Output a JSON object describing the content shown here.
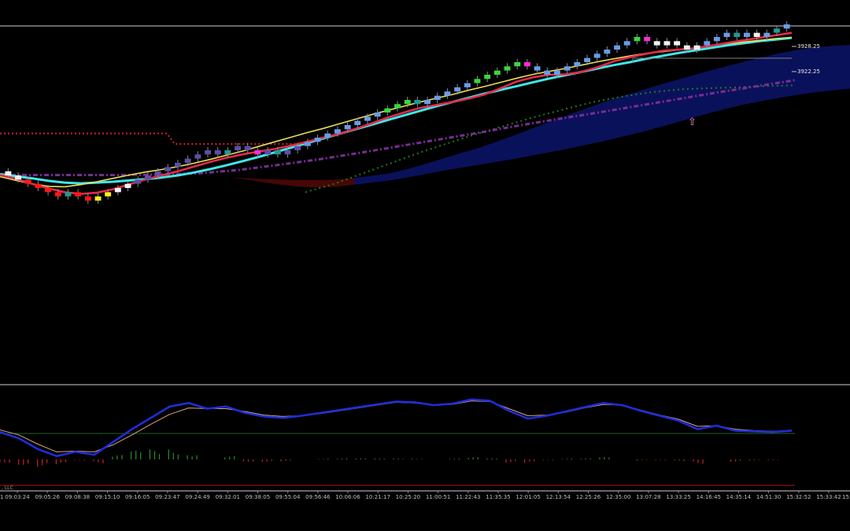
{
  "colors": {
    "background": "#000000",
    "frame": "#cfcfcf",
    "renko_up": "#6a9be8",
    "renko_strong_up": "#38d83a",
    "renko_down": "#5b4ea8",
    "renko_strong_down": "#ff1616",
    "renko_neutral": "#f2f2f2",
    "renko_signal_magenta": "#ff2bd6",
    "renko_signal_teal": "#1f9c95",
    "renko_signal_yellow": "#ffee1a",
    "ma_fast": "#e52a4a",
    "ma_mid": "#e8df55",
    "ma_slow": "#3fe7e9",
    "cloud_bull": "#0b1260",
    "cloud_bear": "#4a0707",
    "dotted_red": "#d21f2f",
    "dotted_green": "#1f7a1f",
    "dotted_purple": "#7a2c93",
    "osc_main": "#1f2dd8",
    "osc_signal": "#d6a37a",
    "hist_pos": "#2f8a2f",
    "hist_neg": "#d02020"
  },
  "chart_data": [
    {
      "type": "line",
      "panel": "price",
      "y_axis_labels": [
        "3928.25",
        "3922.25"
      ],
      "x_tick_labels": [
        "09:03:24",
        "09:05:26",
        "09:08:38",
        "09:15:10",
        "09:16:05",
        "09:23:47",
        "09:24:49",
        "09:32:01",
        "09:38:05",
        "09:55:04",
        "09:56:46",
        "10:06:06",
        "10:21:17",
        "10:25:20",
        "11:00:51",
        "11:22:43",
        "11:35:35",
        "12:01:05",
        "12:13:54",
        "12:25:26",
        "12:35:00",
        "13:07:28",
        "13:33:25",
        "14:16:45",
        "14:35:14",
        "14:51:30",
        "15:32:52",
        "15:33:42"
      ],
      "x_tick_label_left_clipped": "1",
      "x_tick_label_right_clipped": "15:",
      "renko_bricks": [
        {
          "o": 3898.5,
          "c": 3897.5,
          "color": "neutral"
        },
        {
          "o": 3897.5,
          "c": 3896.5,
          "color": "neutral"
        },
        {
          "o": 3896.5,
          "c": 3895.5,
          "color": "strong_down"
        },
        {
          "o": 3895.5,
          "c": 3894.5,
          "color": "strong_down"
        },
        {
          "o": 3894.5,
          "c": 3893.5,
          "color": "strong_down"
        },
        {
          "o": 3893.5,
          "c": 3892.5,
          "color": "strong_down"
        },
        {
          "o": 3892.5,
          "c": 3893.5,
          "color": "teal"
        },
        {
          "o": 3893.5,
          "c": 3892.5,
          "color": "strong_down"
        },
        {
          "o": 3892.5,
          "c": 3891.5,
          "color": "strong_down"
        },
        {
          "o": 3891.5,
          "c": 3892.5,
          "color": "yellow"
        },
        {
          "o": 3892.5,
          "c": 3893.5,
          "color": "yellow"
        },
        {
          "o": 3893.5,
          "c": 3894.5,
          "color": "neutral"
        },
        {
          "o": 3894.5,
          "c": 3895.5,
          "color": "neutral"
        },
        {
          "o": 3895.5,
          "c": 3896.5,
          "color": "down"
        },
        {
          "o": 3896.5,
          "c": 3897.5,
          "color": "down"
        },
        {
          "o": 3897.5,
          "c": 3898.5,
          "color": "down"
        },
        {
          "o": 3898.5,
          "c": 3899.5,
          "color": "down"
        },
        {
          "o": 3899.5,
          "c": 3900.5,
          "color": "down"
        },
        {
          "o": 3900.5,
          "c": 3901.5,
          "color": "down"
        },
        {
          "o": 3901.5,
          "c": 3902.5,
          "color": "down"
        },
        {
          "o": 3902.5,
          "c": 3903.5,
          "color": "down"
        },
        {
          "o": 3903.5,
          "c": 3902.5,
          "color": "down"
        },
        {
          "o": 3902.5,
          "c": 3903.5,
          "color": "teal"
        },
        {
          "o": 3903.5,
          "c": 3904.5,
          "color": "down"
        },
        {
          "o": 3904.5,
          "c": 3903.5,
          "color": "down"
        },
        {
          "o": 3903.5,
          "c": 3902.5,
          "color": "magenta"
        },
        {
          "o": 3902.5,
          "c": 3903.5,
          "color": "down"
        },
        {
          "o": 3903.5,
          "c": 3902.5,
          "color": "teal"
        },
        {
          "o": 3902.5,
          "c": 3903.5,
          "color": "down"
        },
        {
          "o": 3903.5,
          "c": 3904.5,
          "color": "down"
        },
        {
          "o": 3904.5,
          "c": 3905.5,
          "color": "up"
        },
        {
          "o": 3905.5,
          "c": 3906.5,
          "color": "up"
        },
        {
          "o": 3906.5,
          "c": 3907.5,
          "color": "up"
        },
        {
          "o": 3907.5,
          "c": 3908.5,
          "color": "up"
        },
        {
          "o": 3908.5,
          "c": 3909.5,
          "color": "up"
        },
        {
          "o": 3909.5,
          "c": 3910.5,
          "color": "up"
        },
        {
          "o": 3910.5,
          "c": 3911.5,
          "color": "up"
        },
        {
          "o": 3911.5,
          "c": 3912.5,
          "color": "up"
        },
        {
          "o": 3912.5,
          "c": 3913.5,
          "color": "strong_up"
        },
        {
          "o": 3913.5,
          "c": 3914.5,
          "color": "strong_up"
        },
        {
          "o": 3914.5,
          "c": 3915.5,
          "color": "strong_up"
        },
        {
          "o": 3915.5,
          "c": 3914.5,
          "color": "teal"
        },
        {
          "o": 3914.5,
          "c": 3915.5,
          "color": "up"
        },
        {
          "o": 3915.5,
          "c": 3916.5,
          "color": "up"
        },
        {
          "o": 3916.5,
          "c": 3917.5,
          "color": "up"
        },
        {
          "o": 3917.5,
          "c": 3918.5,
          "color": "up"
        },
        {
          "o": 3918.5,
          "c": 3919.5,
          "color": "up"
        },
        {
          "o": 3919.5,
          "c": 3920.5,
          "color": "strong_up"
        },
        {
          "o": 3920.5,
          "c": 3921.5,
          "color": "strong_up"
        },
        {
          "o": 3921.5,
          "c": 3922.5,
          "color": "strong_up"
        },
        {
          "o": 3922.5,
          "c": 3923.5,
          "color": "strong_up"
        },
        {
          "o": 3923.5,
          "c": 3924.5,
          "color": "strong_up"
        },
        {
          "o": 3924.5,
          "c": 3923.5,
          "color": "magenta"
        },
        {
          "o": 3923.5,
          "c": 3922.5,
          "color": "up"
        },
        {
          "o": 3922.5,
          "c": 3921.5,
          "color": "up"
        },
        {
          "o": 3921.5,
          "c": 3922.5,
          "color": "up"
        },
        {
          "o": 3922.5,
          "c": 3923.5,
          "color": "up"
        },
        {
          "o": 3923.5,
          "c": 3924.5,
          "color": "up"
        },
        {
          "o": 3924.5,
          "c": 3925.5,
          "color": "up"
        },
        {
          "o": 3925.5,
          "c": 3926.5,
          "color": "up"
        },
        {
          "o": 3926.5,
          "c": 3927.5,
          "color": "up"
        },
        {
          "o": 3927.5,
          "c": 3928.5,
          "color": "up"
        },
        {
          "o": 3928.5,
          "c": 3929.5,
          "color": "up"
        },
        {
          "o": 3929.5,
          "c": 3930.5,
          "color": "strong_up"
        },
        {
          "o": 3930.5,
          "c": 3929.5,
          "color": "magenta"
        },
        {
          "o": 3929.5,
          "c": 3928.5,
          "color": "neutral"
        },
        {
          "o": 3928.5,
          "c": 3929.5,
          "color": "neutral"
        },
        {
          "o": 3929.5,
          "c": 3928.5,
          "color": "neutral"
        },
        {
          "o": 3928.5,
          "c": 3927.5,
          "color": "neutral"
        },
        {
          "o": 3927.5,
          "c": 3928.5,
          "color": "neutral"
        },
        {
          "o": 3928.5,
          "c": 3929.5,
          "color": "up"
        },
        {
          "o": 3929.5,
          "c": 3930.5,
          "color": "up"
        },
        {
          "o": 3930.5,
          "c": 3931.5,
          "color": "up"
        },
        {
          "o": 3931.5,
          "c": 3930.5,
          "color": "teal"
        },
        {
          "o": 3930.5,
          "c": 3931.5,
          "color": "up"
        },
        {
          "o": 3931.5,
          "c": 3930.5,
          "color": "neutral"
        },
        {
          "o": 3930.5,
          "c": 3931.5,
          "color": "up"
        },
        {
          "o": 3931.5,
          "c": 3932.5,
          "color": "teal"
        },
        {
          "o": 3932.5,
          "c": 3933.5,
          "color": "up"
        }
      ],
      "ma_fast": [
        3897.6,
        3896.7,
        3895.5,
        3894.4,
        3893.5,
        3893.1,
        3893.4,
        3894.2,
        3895.4,
        3896.5,
        3897.5,
        3898.5,
        3899.6,
        3900.7,
        3901.7,
        3902.5,
        3903.2,
        3903.8,
        3904.6,
        3905.5,
        3906.5,
        3907.4,
        3908.6,
        3909.9,
        3911.3,
        3912.5,
        3913.6,
        3914.3,
        3915.0,
        3915.8,
        3916.8,
        3918.3,
        3919.9,
        3920.9,
        3921.5,
        3921.6,
        3922.2,
        3923.3,
        3924.7,
        3925.7,
        3926.5,
        3927.2,
        3927.5,
        3927.8,
        3928.4,
        3929.1,
        3929.7,
        3930.3,
        3930.9,
        3931.5
      ],
      "ma_mid": [
        3897.2,
        3896.3,
        3895.5,
        3894.9,
        3894.8,
        3895.3,
        3896.0,
        3896.8,
        3897.6,
        3898.3,
        3898.9,
        3899.6,
        3900.4,
        3901.3,
        3902.3,
        3903.3,
        3904.4,
        3905.5,
        3906.6,
        3907.7,
        3908.7,
        3909.8,
        3910.9,
        3912.0,
        3913.0,
        3914.0,
        3915.0,
        3915.9,
        3916.8,
        3917.8,
        3918.7,
        3919.7,
        3920.7,
        3921.6,
        3922.3,
        3923.0,
        3923.8,
        3924.6,
        3925.3,
        3926.0,
        3926.6,
        3927.0,
        3927.4,
        3927.9,
        3928.5,
        3928.9,
        3929.3,
        3929.7,
        3930.1,
        3930.4
      ],
      "ma_slow": [
        3897.8,
        3897.3,
        3896.8,
        3896.2,
        3895.8,
        3895.6,
        3895.8,
        3896.0,
        3896.3,
        3896.6,
        3897.0,
        3897.5,
        3898.2,
        3899.0,
        3899.9,
        3900.9,
        3901.9,
        3903.0,
        3904.1,
        3905.2,
        3906.3,
        3907.4,
        3908.5,
        3909.6,
        3910.7,
        3911.8,
        3912.9,
        3914.0,
        3915.0,
        3916.0,
        3917.0,
        3917.9,
        3918.8,
        3919.7,
        3920.6,
        3921.4,
        3922.2,
        3923.0,
        3923.8,
        3924.5,
        3925.3,
        3926.0,
        3926.7,
        3927.3,
        3927.9,
        3928.5,
        3929.0,
        3929.5,
        3929.9,
        3930.3
      ],
      "cloud_top": [
        3898.0,
        3897.8,
        3897.6,
        3897.4,
        3897.2,
        3897.0,
        3896.8,
        3896.6,
        3896.5,
        3896.4,
        3896.4,
        3896.5,
        3896.9,
        3897.4,
        3898.0,
        3899.0,
        3900.2,
        3901.5,
        3902.8,
        3904.0,
        3905.5,
        3907.0,
        3908.6,
        3910.2,
        3911.8,
        3913.3,
        3914.8,
        3916.2,
        3917.5,
        3918.8,
        3920.0,
        3921.2,
        3922.4,
        3923.5,
        3924.6,
        3925.6,
        3926.6,
        3927.4,
        3928.0,
        3928.4,
        3928.6
      ],
      "cloud_bottom": [
        3898.0,
        3897.8,
        3897.6,
        3897.4,
        3897.2,
        3897.0,
        3896.5,
        3895.8,
        3895.2,
        3894.8,
        3894.6,
        3894.8,
        3895.3,
        3895.8,
        3896.3,
        3897.0,
        3897.8,
        3898.6,
        3899.3,
        3900.0,
        3900.7,
        3901.4,
        3902.2,
        3903.0,
        3903.8,
        3904.7,
        3905.6,
        3906.6,
        3907.6,
        3908.7,
        3909.9,
        3911.1,
        3912.3,
        3913.4,
        3914.4,
        3915.2,
        3916.0,
        3916.7,
        3917.3,
        3917.8,
        3918.2
      ],
      "dotted_red_level": [
        3907.5,
        3905.0
      ],
      "dotted_green": [
        3893.5,
        3895.5,
        3898.0,
        3900.5,
        3903.0,
        3905.3,
        3907.5,
        3909.5,
        3911.5,
        3913.3,
        3915.0,
        3916.3,
        3917.3,
        3918.0,
        3918.3,
        3918.5,
        3918.8,
        3919.0
      ],
      "dotted_purple": [
        3897.6,
        3897.6,
        3897.6,
        3897.6,
        3897.7,
        3898.0,
        3898.8,
        3900.0,
        3901.3,
        3902.8,
        3904.4,
        3906.0,
        3907.6,
        3909.3,
        3910.9,
        3912.4,
        3914.0,
        3915.6,
        3917.2,
        3918.7,
        3920.2
      ],
      "signal_arrow": "⇧"
    },
    {
      "type": "bar",
      "panel": "oscillator",
      "osc_main": [
        0.2,
        -0.7,
        -2.2,
        -3.2,
        -2.6,
        -3.0,
        -1.2,
        0.6,
        2.2,
        3.8,
        4.3,
        3.5,
        3.8,
        2.9,
        2.4,
        2.2,
        2.5,
        2.9,
        3.3,
        3.7,
        4.1,
        4.5,
        4.4,
        4.0,
        4.2,
        4.8,
        4.6,
        3.2,
        2.1,
        2.5,
        3.1,
        3.7,
        4.3,
        4.0,
        3.2,
        2.5,
        1.8,
        0.6,
        1.1,
        0.4,
        0.3,
        0.2,
        0.4
      ],
      "osc_signal": [
        0.5,
        -0.2,
        -1.5,
        -2.6,
        -2.5,
        -2.6,
        -1.6,
        -0.2,
        1.3,
        2.7,
        3.6,
        3.5,
        3.5,
        3.1,
        2.6,
        2.4,
        2.5,
        2.8,
        3.2,
        3.6,
        4.0,
        4.4,
        4.3,
        4.0,
        4.1,
        4.6,
        4.5,
        3.5,
        2.5,
        2.6,
        3.0,
        3.6,
        4.1,
        4.0,
        3.3,
        2.6,
        2.0,
        1.0,
        1.1,
        0.6,
        0.4,
        0.3,
        0.4
      ],
      "hist": [
        -0.3,
        -0.5,
        -0.7,
        -0.6,
        -0.1,
        -0.4,
        0.4,
        0.8,
        0.9,
        1.1,
        0.7,
        0.0,
        0.3,
        -0.2,
        -0.2,
        -0.2,
        0.0,
        0.1,
        0.1,
        0.1,
        0.1,
        0.1,
        0.1,
        0.0,
        0.1,
        0.2,
        0.1,
        -0.3,
        -0.4,
        -0.1,
        0.1,
        0.1,
        0.2,
        0.0,
        -0.1,
        -0.1,
        -0.2,
        -0.4,
        0.0,
        -0.2,
        -0.1,
        -0.1,
        0.0
      ],
      "zero_line_color": "#1f5f1f",
      "lower_line_color": "#b01010"
    }
  ],
  "footer": {
    "copyright_fragment": ", LLC"
  }
}
